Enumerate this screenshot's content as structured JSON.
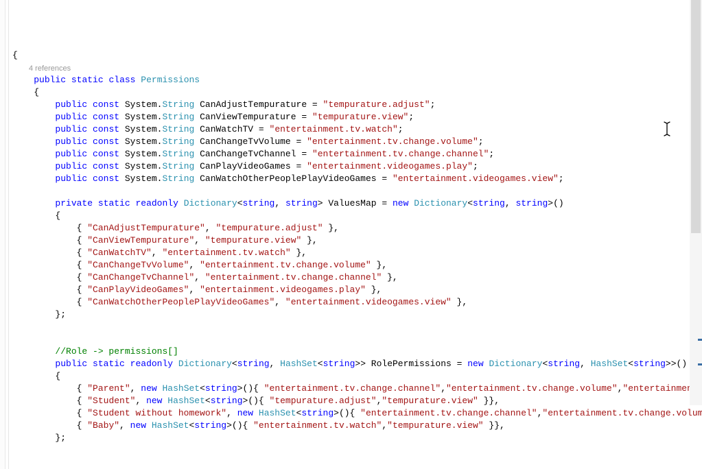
{
  "codelens": "4 references",
  "lines": [
    {
      "indent": 0,
      "tokens": [
        {
          "t": "plain",
          "v": "{"
        }
      ]
    },
    {
      "codelens": true
    },
    {
      "indent": 1,
      "tokens": [
        {
          "t": "kw",
          "v": "public"
        },
        {
          "t": "plain",
          "v": " "
        },
        {
          "t": "kw",
          "v": "static"
        },
        {
          "t": "plain",
          "v": " "
        },
        {
          "t": "kw",
          "v": "class"
        },
        {
          "t": "plain",
          "v": " "
        },
        {
          "t": "type",
          "v": "Permissions"
        }
      ]
    },
    {
      "indent": 1,
      "tokens": [
        {
          "t": "plain",
          "v": "{"
        }
      ]
    },
    {
      "indent": 2,
      "tokens": [
        {
          "t": "kw",
          "v": "public"
        },
        {
          "t": "plain",
          "v": " "
        },
        {
          "t": "kw",
          "v": "const"
        },
        {
          "t": "plain",
          "v": " System."
        },
        {
          "t": "type",
          "v": "String"
        },
        {
          "t": "plain",
          "v": " CanAdjustTempurature = "
        },
        {
          "t": "str",
          "v": "\"tempurature.adjust\""
        },
        {
          "t": "plain",
          "v": ";"
        }
      ]
    },
    {
      "indent": 2,
      "tokens": [
        {
          "t": "kw",
          "v": "public"
        },
        {
          "t": "plain",
          "v": " "
        },
        {
          "t": "kw",
          "v": "const"
        },
        {
          "t": "plain",
          "v": " System."
        },
        {
          "t": "type",
          "v": "String"
        },
        {
          "t": "plain",
          "v": " CanViewTempurature = "
        },
        {
          "t": "str",
          "v": "\"tempurature.view\""
        },
        {
          "t": "plain",
          "v": ";"
        }
      ]
    },
    {
      "indent": 2,
      "tokens": [
        {
          "t": "kw",
          "v": "public"
        },
        {
          "t": "plain",
          "v": " "
        },
        {
          "t": "kw",
          "v": "const"
        },
        {
          "t": "plain",
          "v": " System."
        },
        {
          "t": "type",
          "v": "String"
        },
        {
          "t": "plain",
          "v": " CanWatchTV = "
        },
        {
          "t": "str",
          "v": "\"entertainment.tv.watch\""
        },
        {
          "t": "plain",
          "v": ";"
        }
      ]
    },
    {
      "indent": 2,
      "tokens": [
        {
          "t": "kw",
          "v": "public"
        },
        {
          "t": "plain",
          "v": " "
        },
        {
          "t": "kw",
          "v": "const"
        },
        {
          "t": "plain",
          "v": " System."
        },
        {
          "t": "type",
          "v": "String"
        },
        {
          "t": "plain",
          "v": " CanChangeTvVolume = "
        },
        {
          "t": "str",
          "v": "\"entertainment.tv.change.volume\""
        },
        {
          "t": "plain",
          "v": ";"
        }
      ]
    },
    {
      "indent": 2,
      "tokens": [
        {
          "t": "kw",
          "v": "public"
        },
        {
          "t": "plain",
          "v": " "
        },
        {
          "t": "kw",
          "v": "const"
        },
        {
          "t": "plain",
          "v": " System."
        },
        {
          "t": "type",
          "v": "String"
        },
        {
          "t": "plain",
          "v": " CanChangeTvChannel = "
        },
        {
          "t": "str",
          "v": "\"entertainment.tv.change.channel\""
        },
        {
          "t": "plain",
          "v": ";"
        }
      ]
    },
    {
      "indent": 2,
      "tokens": [
        {
          "t": "kw",
          "v": "public"
        },
        {
          "t": "plain",
          "v": " "
        },
        {
          "t": "kw",
          "v": "const"
        },
        {
          "t": "plain",
          "v": " System."
        },
        {
          "t": "type",
          "v": "String"
        },
        {
          "t": "plain",
          "v": " CanPlayVideoGames = "
        },
        {
          "t": "str",
          "v": "\"entertainment.videogames.play\""
        },
        {
          "t": "plain",
          "v": ";"
        }
      ]
    },
    {
      "indent": 2,
      "tokens": [
        {
          "t": "kw",
          "v": "public"
        },
        {
          "t": "plain",
          "v": " "
        },
        {
          "t": "kw",
          "v": "const"
        },
        {
          "t": "plain",
          "v": " System."
        },
        {
          "t": "type",
          "v": "String"
        },
        {
          "t": "plain",
          "v": " CanWatchOtherPeoplePlayVideoGames = "
        },
        {
          "t": "str",
          "v": "\"entertainment.videogames.view\""
        },
        {
          "t": "plain",
          "v": ";"
        }
      ]
    },
    {
      "blank": true
    },
    {
      "indent": 2,
      "tokens": [
        {
          "t": "kw",
          "v": "private"
        },
        {
          "t": "plain",
          "v": " "
        },
        {
          "t": "kw",
          "v": "static"
        },
        {
          "t": "plain",
          "v": " "
        },
        {
          "t": "kw",
          "v": "readonly"
        },
        {
          "t": "plain",
          "v": " "
        },
        {
          "t": "type",
          "v": "Dictionary"
        },
        {
          "t": "plain",
          "v": "<"
        },
        {
          "t": "kw",
          "v": "string"
        },
        {
          "t": "plain",
          "v": ", "
        },
        {
          "t": "kw",
          "v": "string"
        },
        {
          "t": "plain",
          "v": "> ValuesMap = "
        },
        {
          "t": "kw",
          "v": "new"
        },
        {
          "t": "plain",
          "v": " "
        },
        {
          "t": "type",
          "v": "Dictionary"
        },
        {
          "t": "plain",
          "v": "<"
        },
        {
          "t": "kw",
          "v": "string"
        },
        {
          "t": "plain",
          "v": ", "
        },
        {
          "t": "kw",
          "v": "string"
        },
        {
          "t": "plain",
          "v": ">()"
        }
      ]
    },
    {
      "indent": 2,
      "tokens": [
        {
          "t": "plain",
          "v": "{"
        }
      ]
    },
    {
      "indent": 3,
      "tokens": [
        {
          "t": "plain",
          "v": "{ "
        },
        {
          "t": "str",
          "v": "\"CanAdjustTempurature\""
        },
        {
          "t": "plain",
          "v": ", "
        },
        {
          "t": "str",
          "v": "\"tempurature.adjust\""
        },
        {
          "t": "plain",
          "v": " },"
        }
      ]
    },
    {
      "indent": 3,
      "tokens": [
        {
          "t": "plain",
          "v": "{ "
        },
        {
          "t": "str",
          "v": "\"CanViewTempurature\""
        },
        {
          "t": "plain",
          "v": ", "
        },
        {
          "t": "str",
          "v": "\"tempurature.view\""
        },
        {
          "t": "plain",
          "v": " },"
        }
      ]
    },
    {
      "indent": 3,
      "tokens": [
        {
          "t": "plain",
          "v": "{ "
        },
        {
          "t": "str",
          "v": "\"CanWatchTV\""
        },
        {
          "t": "plain",
          "v": ", "
        },
        {
          "t": "str",
          "v": "\"entertainment.tv.watch\""
        },
        {
          "t": "plain",
          "v": " },"
        }
      ]
    },
    {
      "indent": 3,
      "tokens": [
        {
          "t": "plain",
          "v": "{ "
        },
        {
          "t": "str",
          "v": "\"CanChangeTvVolume\""
        },
        {
          "t": "plain",
          "v": ", "
        },
        {
          "t": "str",
          "v": "\"entertainment.tv.change.volume\""
        },
        {
          "t": "plain",
          "v": " },"
        }
      ]
    },
    {
      "indent": 3,
      "tokens": [
        {
          "t": "plain",
          "v": "{ "
        },
        {
          "t": "str",
          "v": "\"CanChangeTvChannel\""
        },
        {
          "t": "plain",
          "v": ", "
        },
        {
          "t": "str",
          "v": "\"entertainment.tv.change.channel\""
        },
        {
          "t": "plain",
          "v": " },"
        }
      ]
    },
    {
      "indent": 3,
      "tokens": [
        {
          "t": "plain",
          "v": "{ "
        },
        {
          "t": "str",
          "v": "\"CanPlayVideoGames\""
        },
        {
          "t": "plain",
          "v": ", "
        },
        {
          "t": "str",
          "v": "\"entertainment.videogames.play\""
        },
        {
          "t": "plain",
          "v": " },"
        }
      ]
    },
    {
      "indent": 3,
      "tokens": [
        {
          "t": "plain",
          "v": "{ "
        },
        {
          "t": "str",
          "v": "\"CanWatchOtherPeoplePlayVideoGames\""
        },
        {
          "t": "plain",
          "v": ", "
        },
        {
          "t": "str",
          "v": "\"entertainment.videogames.view\""
        },
        {
          "t": "plain",
          "v": " },"
        }
      ]
    },
    {
      "indent": 2,
      "tokens": [
        {
          "t": "plain",
          "v": "};"
        }
      ]
    },
    {
      "blank": true
    },
    {
      "blank": true
    },
    {
      "indent": 2,
      "tokens": [
        {
          "t": "comment",
          "v": "//Role -> permissions[]"
        }
      ]
    },
    {
      "indent": 2,
      "tokens": [
        {
          "t": "kw",
          "v": "public"
        },
        {
          "t": "plain",
          "v": " "
        },
        {
          "t": "kw",
          "v": "static"
        },
        {
          "t": "plain",
          "v": " "
        },
        {
          "t": "kw",
          "v": "readonly"
        },
        {
          "t": "plain",
          "v": " "
        },
        {
          "t": "type",
          "v": "Dictionary"
        },
        {
          "t": "plain",
          "v": "<"
        },
        {
          "t": "kw",
          "v": "string"
        },
        {
          "t": "plain",
          "v": ", "
        },
        {
          "t": "type",
          "v": "HashSet"
        },
        {
          "t": "plain",
          "v": "<"
        },
        {
          "t": "kw",
          "v": "string"
        },
        {
          "t": "plain",
          "v": ">> RolePermissions = "
        },
        {
          "t": "kw",
          "v": "new"
        },
        {
          "t": "plain",
          "v": " "
        },
        {
          "t": "type",
          "v": "Dictionary"
        },
        {
          "t": "plain",
          "v": "<"
        },
        {
          "t": "kw",
          "v": "string"
        },
        {
          "t": "plain",
          "v": ", "
        },
        {
          "t": "type",
          "v": "HashSet"
        },
        {
          "t": "plain",
          "v": "<"
        },
        {
          "t": "kw",
          "v": "string"
        },
        {
          "t": "plain",
          "v": ">>()"
        }
      ]
    },
    {
      "indent": 2,
      "tokens": [
        {
          "t": "plain",
          "v": "{"
        }
      ]
    },
    {
      "indent": 3,
      "tokens": [
        {
          "t": "plain",
          "v": "{ "
        },
        {
          "t": "str",
          "v": "\"Parent\""
        },
        {
          "t": "plain",
          "v": ", "
        },
        {
          "t": "kw",
          "v": "new"
        },
        {
          "t": "plain",
          "v": " "
        },
        {
          "t": "type",
          "v": "HashSet"
        },
        {
          "t": "plain",
          "v": "<"
        },
        {
          "t": "kw",
          "v": "string"
        },
        {
          "t": "plain",
          "v": ">(){ "
        },
        {
          "t": "str",
          "v": "\"entertainment.tv.change.channel\""
        },
        {
          "t": "plain",
          "v": ","
        },
        {
          "t": "str",
          "v": "\"entertainment.tv.change.volume\""
        },
        {
          "t": "plain",
          "v": ","
        },
        {
          "t": "str",
          "v": "\"entertainment.tv"
        }
      ]
    },
    {
      "indent": 3,
      "tokens": [
        {
          "t": "plain",
          "v": "{ "
        },
        {
          "t": "str",
          "v": "\"Student\""
        },
        {
          "t": "plain",
          "v": ", "
        },
        {
          "t": "kw",
          "v": "new"
        },
        {
          "t": "plain",
          "v": " "
        },
        {
          "t": "type",
          "v": "HashSet"
        },
        {
          "t": "plain",
          "v": "<"
        },
        {
          "t": "kw",
          "v": "string"
        },
        {
          "t": "plain",
          "v": ">(){ "
        },
        {
          "t": "str",
          "v": "\"tempurature.adjust\""
        },
        {
          "t": "plain",
          "v": ","
        },
        {
          "t": "str",
          "v": "\"tempurature.view\""
        },
        {
          "t": "plain",
          "v": " }},"
        }
      ]
    },
    {
      "indent": 3,
      "tokens": [
        {
          "t": "plain",
          "v": "{ "
        },
        {
          "t": "str",
          "v": "\"Student without homework\""
        },
        {
          "t": "plain",
          "v": ", "
        },
        {
          "t": "kw",
          "v": "new"
        },
        {
          "t": "plain",
          "v": " "
        },
        {
          "t": "type",
          "v": "HashSet"
        },
        {
          "t": "plain",
          "v": "<"
        },
        {
          "t": "kw",
          "v": "string"
        },
        {
          "t": "plain",
          "v": ">(){ "
        },
        {
          "t": "str",
          "v": "\"entertainment.tv.change.channel\""
        },
        {
          "t": "plain",
          "v": ","
        },
        {
          "t": "str",
          "v": "\"entertainment.tv.change.volume\""
        }
      ]
    },
    {
      "indent": 3,
      "tokens": [
        {
          "t": "plain",
          "v": "{ "
        },
        {
          "t": "str",
          "v": "\"Baby\""
        },
        {
          "t": "plain",
          "v": ", "
        },
        {
          "t": "kw",
          "v": "new"
        },
        {
          "t": "plain",
          "v": " "
        },
        {
          "t": "type",
          "v": "HashSet"
        },
        {
          "t": "plain",
          "v": "<"
        },
        {
          "t": "kw",
          "v": "string"
        },
        {
          "t": "plain",
          "v": ">(){ "
        },
        {
          "t": "str",
          "v": "\"entertainment.tv.watch\""
        },
        {
          "t": "plain",
          "v": ","
        },
        {
          "t": "str",
          "v": "\"tempurature.view\""
        },
        {
          "t": "plain",
          "v": " }},"
        }
      ]
    },
    {
      "indent": 2,
      "tokens": [
        {
          "t": "plain",
          "v": "};"
        }
      ]
    }
  ]
}
